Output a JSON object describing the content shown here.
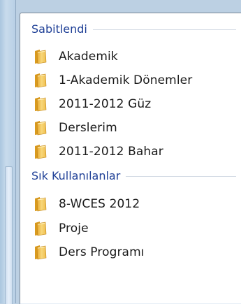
{
  "sections": [
    {
      "header": "Sabitlendi",
      "items": [
        {
          "label": "Akademik",
          "icon": "folder-icon"
        },
        {
          "label": "1-Akademik Dönemler",
          "icon": "folder-icon"
        },
        {
          "label": "2011-2012 Güz",
          "icon": "folder-icon"
        },
        {
          "label": "Derslerim",
          "icon": "folder-icon"
        },
        {
          "label": "2011-2012 Bahar",
          "icon": "folder-icon"
        }
      ]
    },
    {
      "header": "Sık Kullanılanlar",
      "items": [
        {
          "label": "8-WCES 2012",
          "icon": "folder-icon"
        },
        {
          "label": "Proje",
          "icon": "folder-icon"
        },
        {
          "label": "Ders Programı",
          "icon": "folder-icon"
        }
      ]
    }
  ],
  "colors": {
    "header_text": "#1e3f96",
    "folder_body": "#f2c14e",
    "folder_dark": "#d99a1e"
  }
}
